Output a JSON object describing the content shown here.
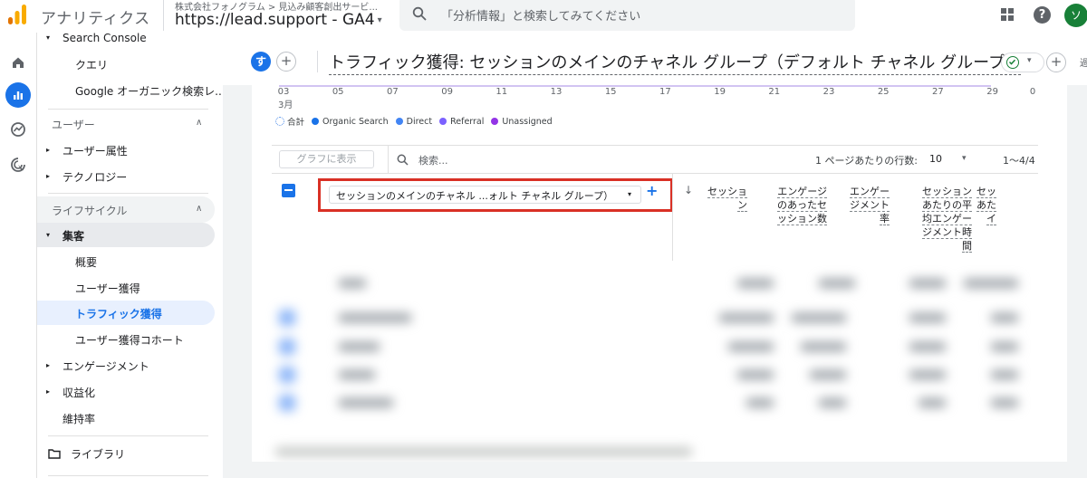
{
  "topbar": {
    "app_title": "アナリティクス",
    "account_path": "株式会社フォノグラム > 見込み顧客創出サービ...",
    "property_name": "https://lead.support - GA4",
    "property_caret": "▾",
    "search_placeholder": "「分析情報」と検索してみてください",
    "help_label": "?",
    "avatar_initial": "ソ"
  },
  "sidebar": {
    "search_console": "Search Console",
    "queries": "クエリ",
    "organic_google": "Google オーガニック検索レ...",
    "users_section": "ユーザー",
    "user_attributes": "ユーザー属性",
    "technology": "テクノロジー",
    "lifecycle_section": "ライフサイクル",
    "acquisition": "集客",
    "overview": "概要",
    "user_acquisition": "ユーザー獲得",
    "traffic_acquisition": "トラフィック獲得",
    "user_acq_cohort": "ユーザー獲得コホート",
    "engagement": "エンゲージメント",
    "monetization": "収益化",
    "retention": "維持率",
    "library": "ライブラリ",
    "chevron_up": "∧",
    "arrow_right": "▸",
    "arrow_down": "▾"
  },
  "report": {
    "user_badge": "す",
    "add_label": "+",
    "title": "トラフィック獲得: セッションのメインのチャネル グループ（デフォルト チャネル グループ）",
    "status_caret": "▾",
    "truncated": "過"
  },
  "chart_data": {
    "type": "line",
    "x_ticks": [
      "03",
      "05",
      "07",
      "09",
      "11",
      "13",
      "15",
      "17",
      "19",
      "21",
      "23",
      "25",
      "27",
      "29"
    ],
    "x_sub": "3月",
    "y_tick_right": "0",
    "series": [
      {
        "name": "合計",
        "color": "#4a8ae8"
      },
      {
        "name": "Organic Search",
        "color": "#1a73e8"
      },
      {
        "name": "Direct",
        "color": "#4285f4"
      },
      {
        "name": "Referral",
        "color": "#7b61ff"
      },
      {
        "name": "Unassigned",
        "color": "#9334e6"
      }
    ]
  },
  "table": {
    "graph_button": "グラフに表示",
    "search_placeholder": "検索...",
    "rows_per_page_label": "1 ページあたりの行数:",
    "rows_per_page_value": "10",
    "rows_caret": "▾",
    "range": "1〜4/4",
    "dimension": "セッションのメインのチャネル ...ォルト チャネル グループ）",
    "dimension_caret": "▾",
    "add_dimension": "+",
    "sort_arrow": "↓",
    "columns": [
      [
        "セッショ",
        "ン"
      ],
      [
        "エンゲージ",
        "のあったセ",
        "ッション数"
      ],
      [
        "エンゲー",
        "ジメント",
        "率"
      ],
      [
        "セッション",
        "あたりの平",
        "均エンゲー",
        "ジメント時",
        "間"
      ],
      [
        "セッ",
        "あた",
        "イ"
      ]
    ]
  }
}
